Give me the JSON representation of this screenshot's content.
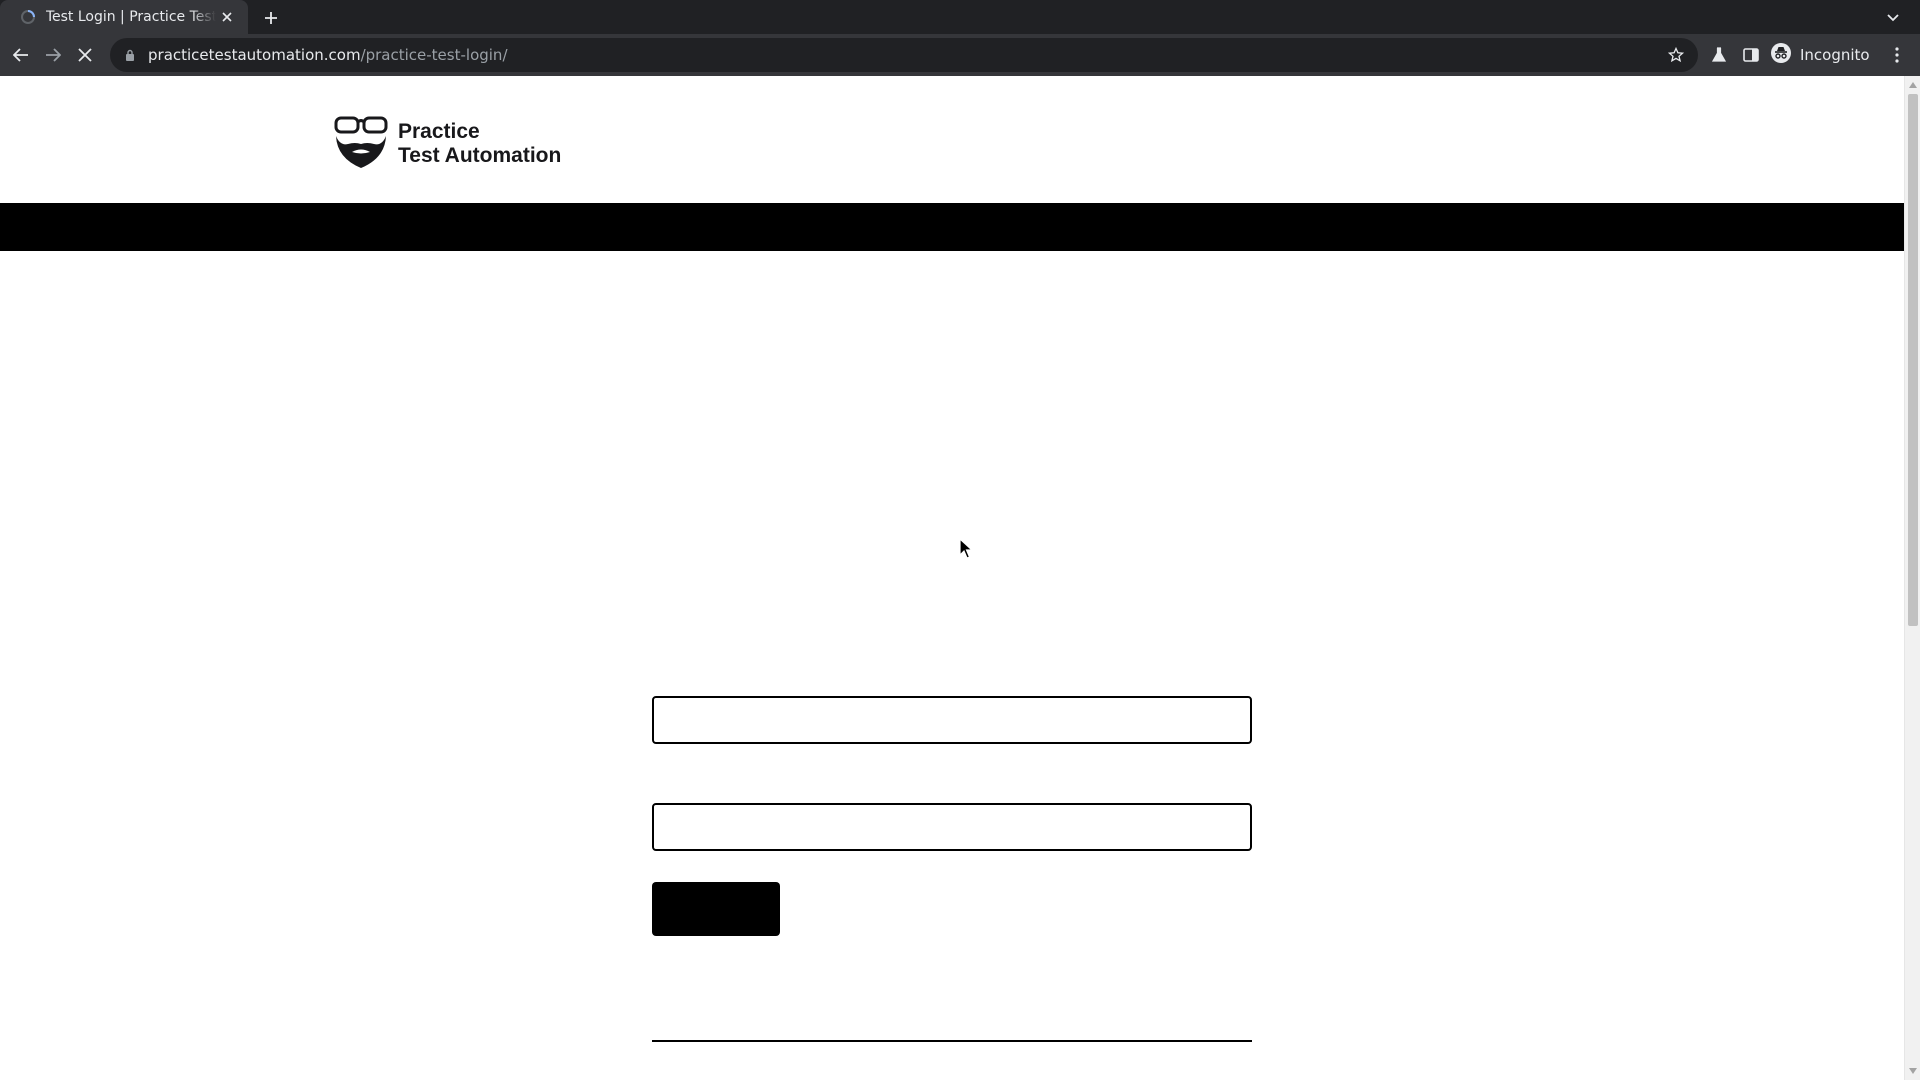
{
  "browser": {
    "tab": {
      "title": "Test Login | Practice Test Automation"
    },
    "omnibox": {
      "host": "practicetestautomation.com",
      "path": "/practice-test-login/"
    },
    "profile_label": "Incognito",
    "icons": {
      "back": "back-arrow-icon",
      "forward": "forward-arrow-icon",
      "stop": "stop-loading-icon",
      "lock": "lock-icon",
      "star": "bookmark-star-icon",
      "labs": "labs-flask-icon",
      "sidepanel": "side-panel-icon",
      "menu": "kebab-menu-icon"
    }
  },
  "site": {
    "logo": {
      "line1": "Practice",
      "line2": "Test Automation"
    }
  },
  "form": {
    "username": {
      "value": "",
      "placeholder": ""
    },
    "password": {
      "value": "",
      "placeholder": ""
    },
    "submit_label": ""
  },
  "colors": {
    "chrome_dark": "#202124",
    "chrome_toolbar": "#35363a",
    "navbar": "#000000",
    "button": "#000000"
  }
}
